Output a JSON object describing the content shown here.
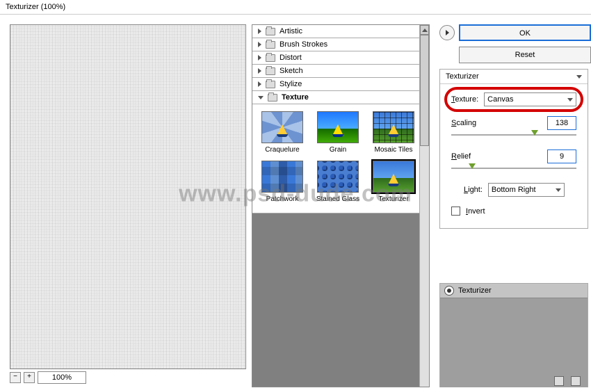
{
  "window": {
    "title": "Texturizer (100%)"
  },
  "zoom": {
    "minus": "−",
    "plus": "+",
    "value": "100%"
  },
  "categories": [
    {
      "label": "Artistic",
      "open": false
    },
    {
      "label": "Brush Strokes",
      "open": false
    },
    {
      "label": "Distort",
      "open": false
    },
    {
      "label": "Sketch",
      "open": false
    },
    {
      "label": "Stylize",
      "open": false
    },
    {
      "label": "Texture",
      "open": true
    }
  ],
  "thumbs": [
    {
      "label": "Craquelure"
    },
    {
      "label": "Grain"
    },
    {
      "label": "Mosaic Tiles"
    },
    {
      "label": "Patchwork"
    },
    {
      "label": "Stained Glass"
    },
    {
      "label": "Texturizer"
    }
  ],
  "buttons": {
    "ok": "OK",
    "reset": "Reset"
  },
  "group": {
    "title": "Texturizer"
  },
  "controls": {
    "texture_label": "Texture:",
    "texture_value": "Canvas",
    "scaling_label": "Scaling",
    "scaling_value": "138",
    "relief_label": "Relief",
    "relief_value": "9",
    "light_label": "Light:",
    "light_value": "Bottom Right",
    "invert_label": "Invert"
  },
  "layer": {
    "name": "Texturizer"
  },
  "watermark": "www.psd-dude.com"
}
